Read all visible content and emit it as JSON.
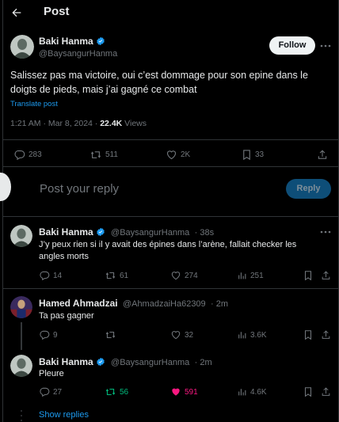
{
  "header": {
    "title": "Post"
  },
  "main_post": {
    "author_name": "Baki Hanma",
    "author_handle": "@BaysangurHanma",
    "follow_label": "Follow",
    "text": "Salissez pas ma victoire, oui c’est dommage pour son epine dans le doigts de pieds, mais j’ai gagné ce combat",
    "translate_label": "Translate post",
    "timestamp": "1:21 AM · Mar 8, 2024 · ",
    "views_count": "22.4K",
    "views_label": " Views",
    "replies": "283",
    "reposts": "511",
    "likes": "2K",
    "bookmarks": "33"
  },
  "composer": {
    "placeholder": "Post your reply",
    "reply_label": "Reply"
  },
  "replies": [
    {
      "author_name": "Baki Hanma",
      "author_handle": "@BaysangurHanma",
      "time": "· 38s",
      "text": "J’y peux rien si il y avait des épines dans l’arène, fallait checker les angles morts",
      "replies": "14",
      "reposts": "61",
      "likes": "274",
      "views": "251"
    },
    {
      "author_name": "Hamed Ahmadzai",
      "author_handle": "@AhmadzaiHa62309",
      "time": "· 2m",
      "text": "Ta pas gagner",
      "replies": "9",
      "reposts": "",
      "likes": "32",
      "views": "3.6K"
    },
    {
      "author_name": "Baki Hanma",
      "author_handle": "@BaysangurHanma",
      "time": "· 2m",
      "text": "Pleure",
      "replies": "27",
      "reposts": "56",
      "likes": "591",
      "views": "4.6K"
    }
  ],
  "show_replies_label": "Show replies",
  "colors": {
    "accent": "#1d9bf0",
    "repost_active": "#00ba7c",
    "like_active": "#f91880",
    "muted": "#71767b"
  }
}
